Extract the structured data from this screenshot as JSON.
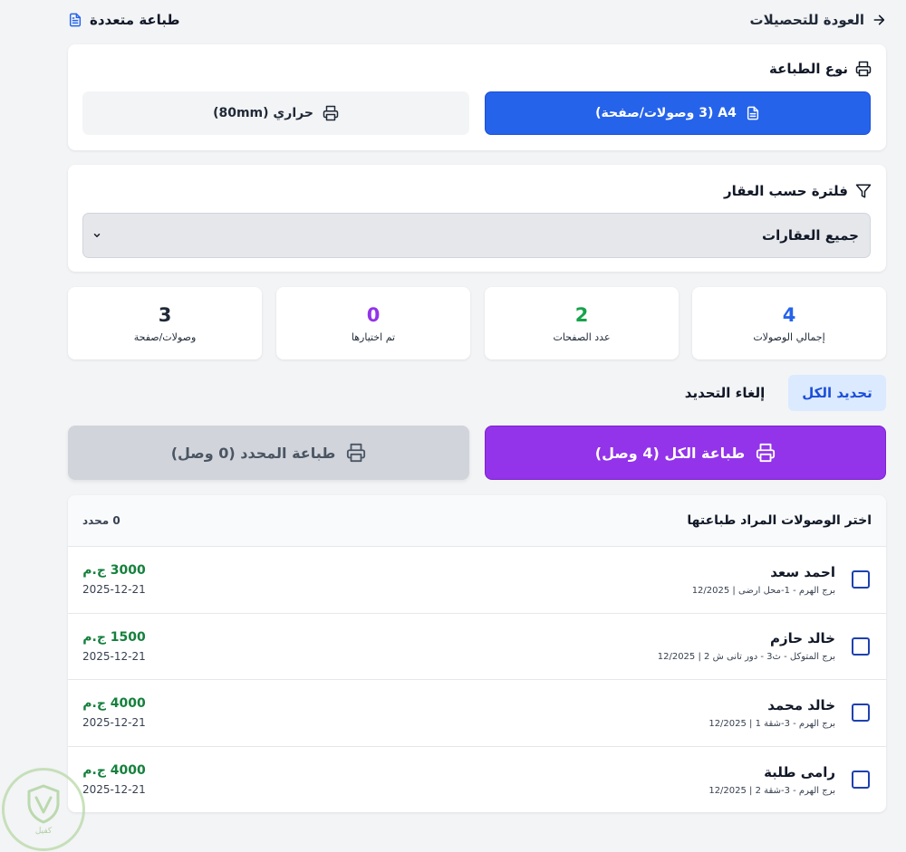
{
  "header": {
    "back_label": "العودة للتحصيلات",
    "page_title": "طباعة متعددة"
  },
  "print_type": {
    "title": "نوع الطباعة",
    "options": [
      {
        "label": "A4 (3 وصولات/صفحة)",
        "selected": true
      },
      {
        "label": "حراري (80mm)",
        "selected": false
      }
    ]
  },
  "filter": {
    "title": "فلترة حسب العقار",
    "selected": "جميع العقارات"
  },
  "stats": [
    {
      "value": "4",
      "label": "إجمالي الوصولات",
      "color": "#2563eb"
    },
    {
      "value": "2",
      "label": "عدد الصفحات",
      "color": "#16a34a"
    },
    {
      "value": "0",
      "label": "تم اختيارها",
      "color": "#9333ea"
    },
    {
      "value": "3",
      "label": "وصولات/صفحة",
      "color": "#1f2937"
    }
  ],
  "selection": {
    "select_all": "تحديد الكل",
    "deselect": "إلغاء التحديد"
  },
  "actions": {
    "print_all": "طباعة الكل (4 وصل)",
    "print_selected": "طباعة المحدد (0 وصل)"
  },
  "list": {
    "title": "اختر الوصولات المراد طباعتها",
    "selected_count": "0 محدد",
    "items": [
      {
        "name": "احمد سعد",
        "details": "برج الهرم - 1-محل ارضى | 12/2025",
        "amount": "3000 ج.م",
        "date": "2025-12-21",
        "checked": false
      },
      {
        "name": "خالد حازم",
        "details": "برج المتوكل - ث3 - دور تانى ش 2 | 12/2025",
        "amount": "1500 ج.م",
        "date": "2025-12-21",
        "checked": false
      },
      {
        "name": "خالد محمد",
        "details": "برج الهرم - 3-شقة 1 | 12/2025",
        "amount": "4000 ج.م",
        "date": "2025-12-21",
        "checked": false
      },
      {
        "name": "رامى طلبة",
        "details": "برج الهرم - 3-شقة 2 | 12/2025",
        "amount": "4000 ج.م",
        "date": "2025-12-21",
        "checked": false
      }
    ]
  },
  "watermark": {
    "text": "كفيل"
  },
  "colors": {
    "primary": "#2563eb",
    "purple": "#9333ea",
    "success": "#15803d"
  }
}
